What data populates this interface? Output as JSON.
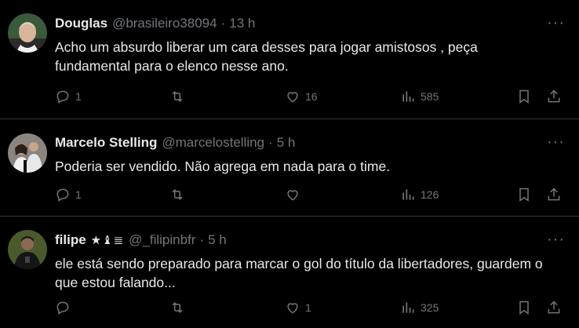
{
  "tweets": [
    {
      "name": "Douglas",
      "badges": "",
      "handle": "@brasileiro38094",
      "time": "13 h",
      "text": "Acho um absurdo liberar um cara desses para jogar amistosos , peça fundamental para o elenco nesse ano.",
      "replies": "1",
      "retweets": "",
      "likes": "16",
      "views": "585"
    },
    {
      "name": "Marcelo Stelling",
      "badges": "",
      "handle": "@marcelostelling",
      "time": "5 h",
      "text": "Poderia ser vendido. Não agrega em nada para o time.",
      "replies": "1",
      "retweets": "",
      "likes": "",
      "views": "126"
    },
    {
      "name": "filipe",
      "badges": "★♝≣",
      "handle": "@_filipinbfr",
      "time": "5 h",
      "text": "ele está sendo preparado para marcar o gol do título da libertadores, guardem o que estou falando...",
      "replies": "",
      "retweets": "",
      "likes": "1",
      "views": "325"
    }
  ],
  "separator": "·",
  "more_glyph": "···",
  "icons": [
    "reply-icon",
    "retweet-icon",
    "like-icon",
    "views-icon",
    "bookmark-icon",
    "share-icon",
    "more-icon"
  ],
  "colors": {
    "background": "#000000",
    "text": "#e7e9ea",
    "muted": "#71767b",
    "divider": "#2f3336"
  }
}
